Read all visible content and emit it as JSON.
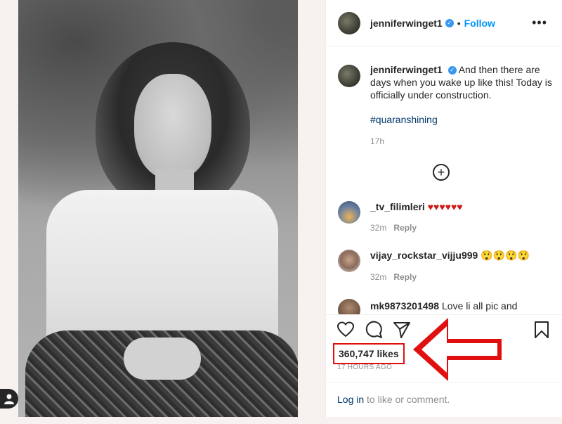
{
  "post": {
    "username": "jenniferwinget1",
    "follow_label": "Follow",
    "more_label": "•••",
    "caption_text": "And then there are days when you wake up like this! Today is officially under construction.",
    "hashtag": "#quaranshining",
    "caption_time": "17h"
  },
  "comments": [
    {
      "username": "_tv_filimleri",
      "text": "♥♥♥♥♥♥",
      "time": "32m",
      "reply_label": "Reply"
    },
    {
      "username": "vijay_rockstar_vijju999",
      "text": "😲😲😲😲",
      "time": "32m",
      "reply_label": "Reply"
    },
    {
      "username": "mk9873201498",
      "text": "Love li all pic and"
    }
  ],
  "footer": {
    "likes": "360,747 likes",
    "time_ago": "17 HOURS AGO",
    "login_link": "Log in",
    "login_rest": " to like or comment."
  },
  "colors": {
    "accent": "#0095f6",
    "annotation_red": "#e01010"
  },
  "icons": [
    "user-icon",
    "verified-icon",
    "more-icon",
    "add-comment-icon",
    "heart-icon",
    "comment-icon",
    "share-icon",
    "bookmark-icon",
    "arrow-annotation"
  ]
}
